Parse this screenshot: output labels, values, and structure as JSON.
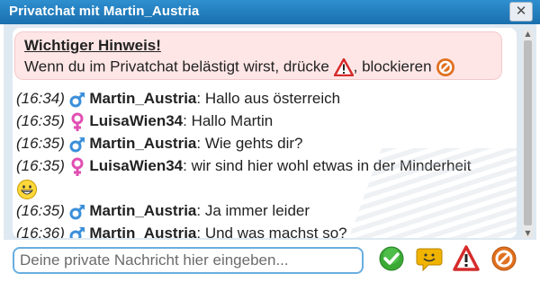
{
  "window": {
    "title": "Privatchat mit Martin_Austria",
    "close_label": "✕"
  },
  "notice": {
    "heading": "Wichtiger Hinweis!",
    "text_part1": "Wenn du im Privatchat belästigt wirst, drücke",
    "text_part2": ", blockieren",
    "warning_icon": "warning-triangle-icon",
    "block_icon": "block-icon"
  },
  "messages": [
    {
      "time": "(16:34)",
      "gender": "male",
      "user": "Martin_Austria",
      "text": ": Hallo aus österreich"
    },
    {
      "time": "(16:35)",
      "gender": "female",
      "user": "LuisaWien34",
      "text": ": Hallo Martin"
    },
    {
      "time": "(16:35)",
      "gender": "male",
      "user": "Martin_Austria",
      "text": ": Wie gehts dir?"
    },
    {
      "time": "(16:35)",
      "gender": "female",
      "user": "LuisaWien34",
      "text": ": wir sind hier wohl etwas in der Minderheit",
      "emoji": "grin-smiley"
    },
    {
      "time": "(16:35)",
      "gender": "male",
      "user": "Martin_Austria",
      "text": ": Ja immer leider"
    },
    {
      "time": "(16:36)",
      "gender": "male",
      "user": "Martin_Austria",
      "text": ": Und was machst so?"
    }
  ],
  "input": {
    "placeholder": "Deine private Nachricht hier eingeben...",
    "value": ""
  },
  "buttons": [
    "send-check-icon",
    "smiley-bubble-icon",
    "report-warning-icon",
    "block-icon"
  ],
  "colors": {
    "title_bar": "#1f7cbf",
    "notice_bg": "#ffe6e6",
    "male": "#3b8fd9",
    "female": "#e04fb3",
    "send": "#3aaa35",
    "warning": "#d62b2b",
    "block": "#e07020",
    "input_border": "#69aee0"
  }
}
